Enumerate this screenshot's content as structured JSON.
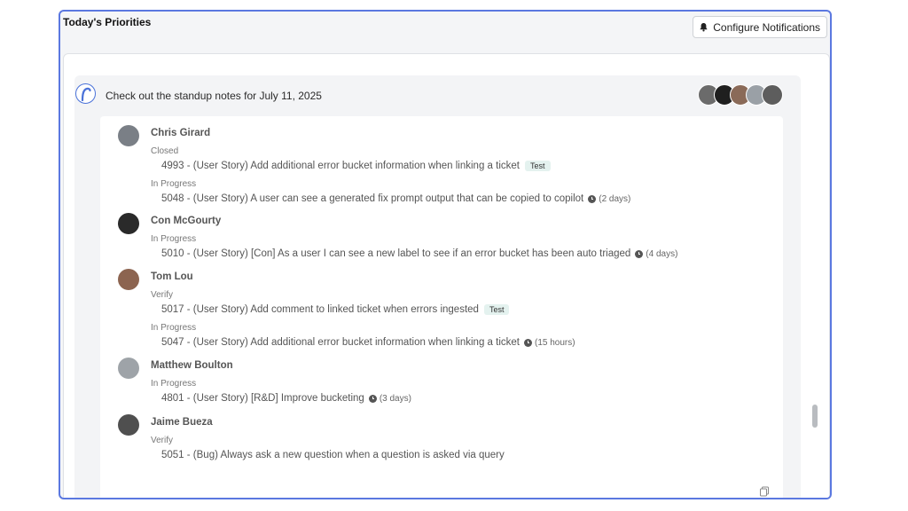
{
  "header": {
    "title": "Today's Priorities",
    "configure_label": "Configure Notifications",
    "bell_icon": "bell-icon"
  },
  "card": {
    "headline": "Check out the standup notes for July 11, 2025",
    "logo_icon": "r-logo-icon",
    "avatar_colors": [
      "#6b6b6b",
      "#1f1f1f",
      "#8a6a58",
      "#9aa0a6",
      "#5d5d5d"
    ]
  },
  "people": [
    {
      "name": "Chris Girard",
      "avatar_color": "#7a7f86",
      "groups": [
        {
          "status": "Closed",
          "items": [
            {
              "text": "4993 - (User Story) Add additional error bucket information when linking a ticket",
              "tag": "Test",
              "duration": ""
            }
          ]
        },
        {
          "status": "In Progress",
          "items": [
            {
              "text": "5048 - (User Story) A user can see a generated fix prompt output that can be copied to copilot",
              "tag": "",
              "duration": "(2 days)"
            }
          ]
        }
      ]
    },
    {
      "name": "Con McGourty",
      "avatar_color": "#2a2a2a",
      "groups": [
        {
          "status": "In Progress",
          "items": [
            {
              "text": "5010 - (User Story) [Con] As a user I can see a new label to see if an error bucket has been auto triaged",
              "tag": "",
              "duration": "(4 days)"
            }
          ]
        }
      ]
    },
    {
      "name": "Tom Lou",
      "avatar_color": "#8c6450",
      "groups": [
        {
          "status": "Verify",
          "items": [
            {
              "text": "5017 - (User Story) Add comment to linked ticket when errors ingested",
              "tag": "Test",
              "duration": ""
            }
          ]
        },
        {
          "status": "In Progress",
          "items": [
            {
              "text": "5047 - (User Story) Add additional error bucket information when linking a ticket",
              "tag": "",
              "duration": "(15 hours)"
            }
          ]
        }
      ]
    },
    {
      "name": "Matthew Boulton",
      "avatar_color": "#9ea3a8",
      "groups": [
        {
          "status": "In Progress",
          "items": [
            {
              "text": "4801 - (User Story) [R&D] Improve bucketing",
              "tag": "",
              "duration": "(3 days)"
            }
          ]
        }
      ]
    },
    {
      "name": "Jaime Bueza",
      "avatar_color": "#4f4f4f",
      "groups": [
        {
          "status": "Verify",
          "items": [
            {
              "text": "5051 - (Bug) Always ask a new question when a question is asked via query",
              "tag": "",
              "duration": ""
            }
          ]
        }
      ]
    }
  ]
}
